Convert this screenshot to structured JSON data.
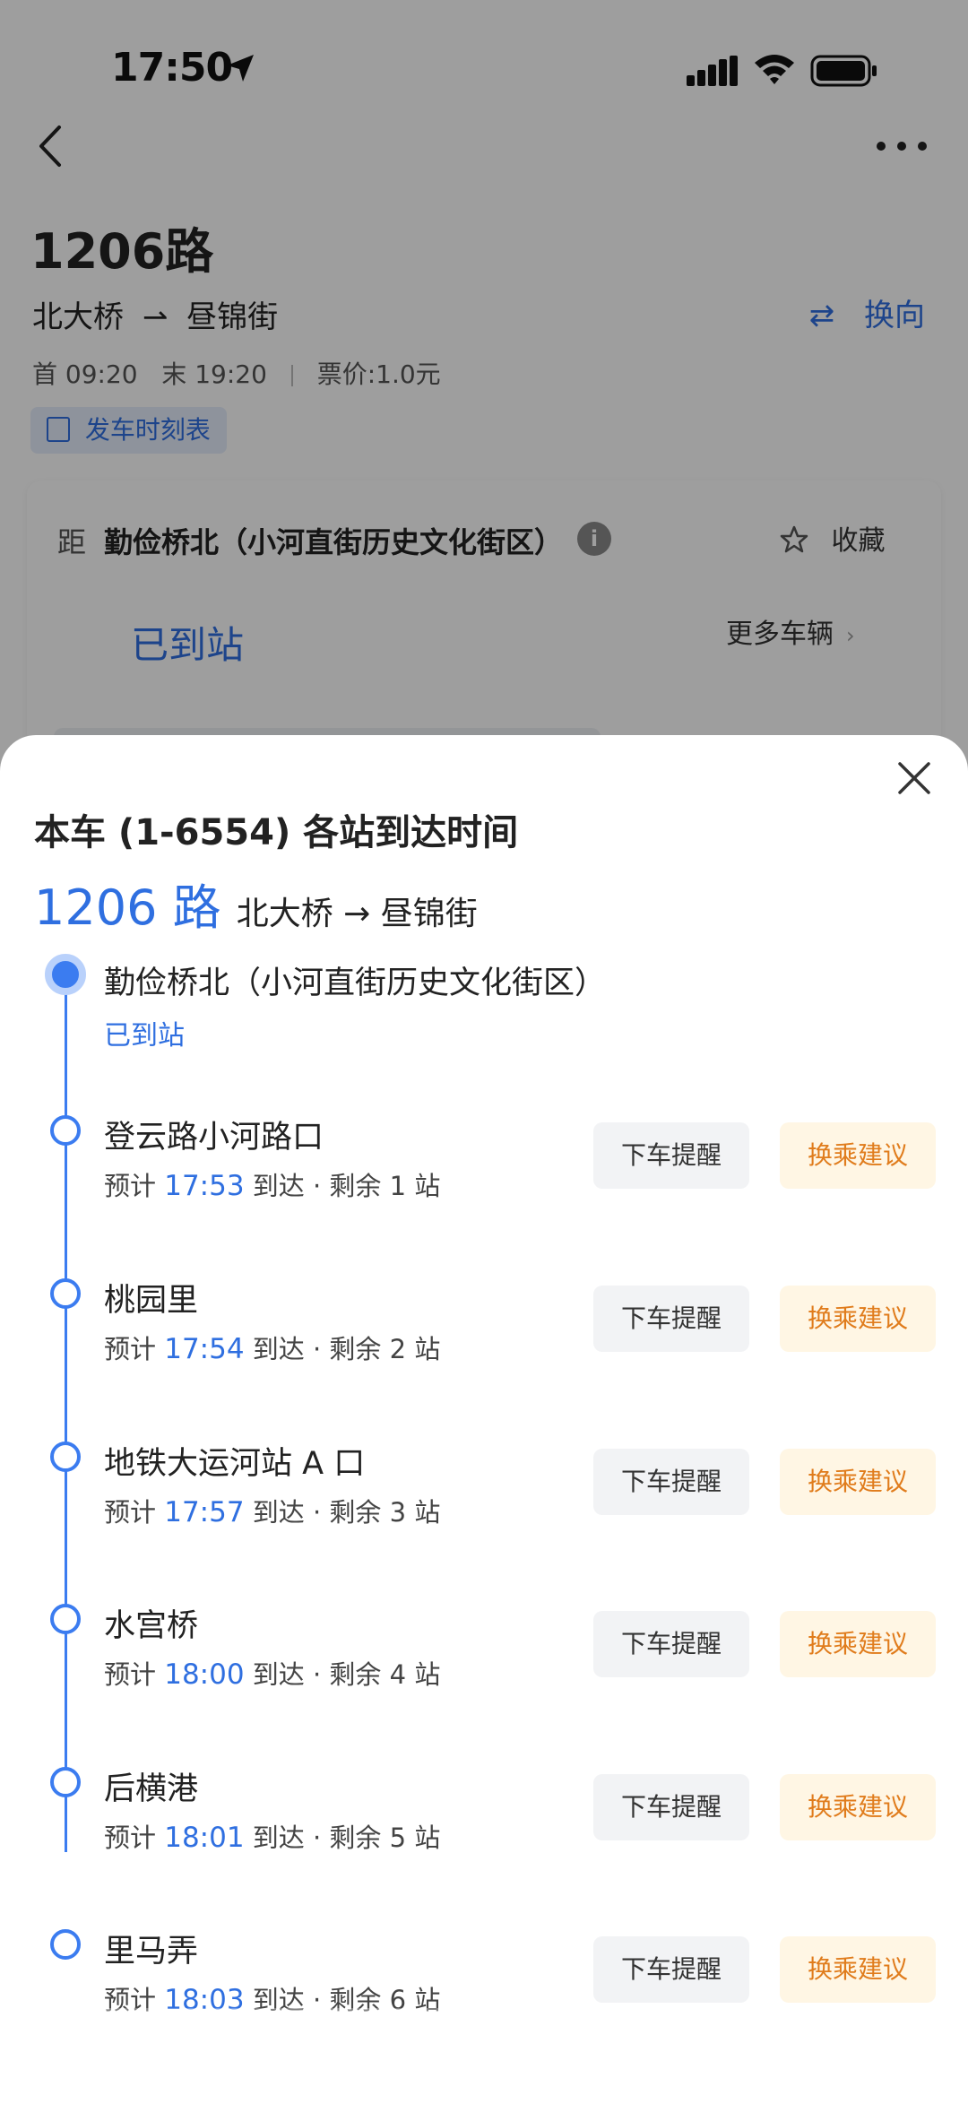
{
  "status": {
    "time": "17:50"
  },
  "route": {
    "title": "1206路",
    "from": "北大桥",
    "to": "昼锦街",
    "swap_label": "换向",
    "first_bus": "首 09:20",
    "last_bus": "末 19:20",
    "fare": "票价:1.0元",
    "timetable_label": "发车时刻表"
  },
  "card": {
    "dist_label": "距",
    "stop_name": "勤俭桥北（小河直街历史文化街区）",
    "favorite_label": "收藏",
    "arrived_label": "已到站",
    "more_vehicles_label": "更多车辆"
  },
  "sheet": {
    "title": "本车 (1-6554) 各站到达时间",
    "route_num": "1206 路",
    "route_dir": "北大桥 → 昼锦街",
    "current_stop": {
      "name": "勤俭桥北（小河直街历史文化街区）",
      "status": "已到站"
    },
    "alert_label": "下车提醒",
    "transfer_label": "换乘建议",
    "stops": [
      {
        "name": "登云路小河路口",
        "eta_prefix": "预计 ",
        "time": "17:53",
        "eta_suffix": " 到达 · 剩余 1 站"
      },
      {
        "name": "桃园里",
        "eta_prefix": "预计 ",
        "time": "17:54",
        "eta_suffix": " 到达 · 剩余 2 站"
      },
      {
        "name": "地铁大运河站 A 口",
        "eta_prefix": "预计 ",
        "time": "17:57",
        "eta_suffix": " 到达 · 剩余 3 站"
      },
      {
        "name": "水宫桥",
        "eta_prefix": "预计 ",
        "time": "18:00",
        "eta_suffix": " 到达 · 剩余 4 站"
      },
      {
        "name": "后横港",
        "eta_prefix": "预计 ",
        "time": "18:01",
        "eta_suffix": " 到达 · 剩余 5 站"
      },
      {
        "name": "里马弄",
        "eta_prefix": "预计 ",
        "time": "18:03",
        "eta_suffix": " 到达 · 剩余 6 站"
      }
    ]
  },
  "colors": {
    "accent": "#2f6fe0",
    "transfer": "#e07c1c",
    "overlay": "rgba(0,0,0,0.38)"
  }
}
